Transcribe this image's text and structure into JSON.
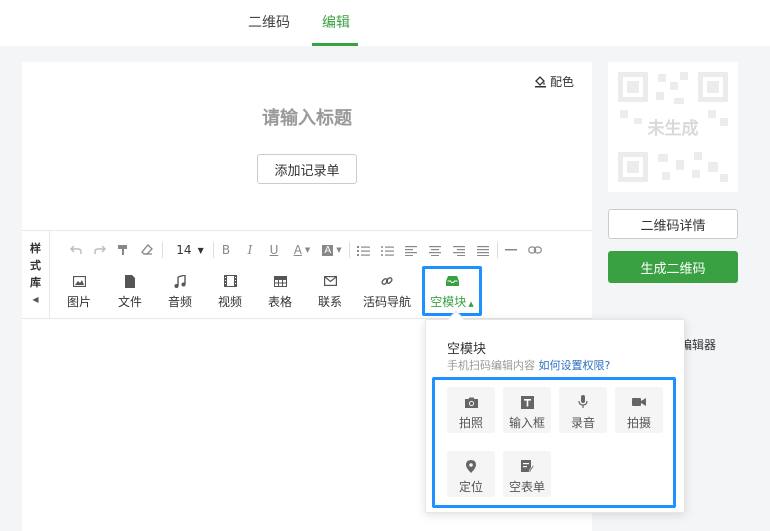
{
  "tabs": [
    {
      "label": "二维码",
      "active": false
    },
    {
      "label": "编辑",
      "active": true
    }
  ],
  "editor": {
    "palette_label": "配色",
    "title_placeholder": "请输入标题",
    "add_form_label": "添加记录单",
    "style_library": [
      "样",
      "式",
      "库"
    ],
    "font_size": "14",
    "format": {
      "bold": "B",
      "italic": "I",
      "underline": "U",
      "font_color": "A",
      "bg_color": "A"
    },
    "insert_items": [
      {
        "label": "图片",
        "icon": "image-icon"
      },
      {
        "label": "文件",
        "icon": "file-icon"
      },
      {
        "label": "音频",
        "icon": "music-icon"
      },
      {
        "label": "视频",
        "icon": "video-icon"
      },
      {
        "label": "表格",
        "icon": "table-icon"
      },
      {
        "label": "联系",
        "icon": "mail-icon"
      },
      {
        "label": "活码导航",
        "icon": "link-icon"
      },
      {
        "label": "空模块",
        "icon": "inbox-icon",
        "active": true
      }
    ]
  },
  "popup": {
    "title": "空模块",
    "desc": "手机扫码编辑内容",
    "link": "如何设置权限?",
    "modules": [
      {
        "label": "拍照",
        "icon": "camera-icon"
      },
      {
        "label": "输入框",
        "icon": "text-icon"
      },
      {
        "label": "录音",
        "icon": "mic-icon"
      },
      {
        "label": "拍摄",
        "icon": "video-camera-icon"
      },
      {
        "label": "定位",
        "icon": "location-icon"
      },
      {
        "label": "空表单",
        "icon": "form-icon"
      }
    ]
  },
  "sidebar": {
    "qr_status": "未生成",
    "qr_detail_label": "二维码详情",
    "generate_label": "生成二维码",
    "partial_text": "编辑器"
  },
  "colors": {
    "accent": "#3aa142",
    "highlight": "#1e90ff",
    "link": "#2d6fc2"
  }
}
